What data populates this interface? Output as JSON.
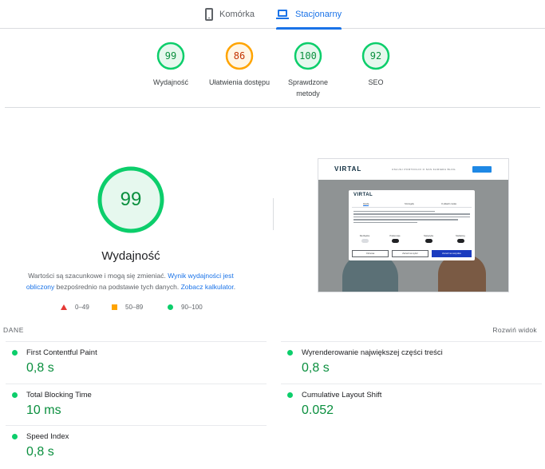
{
  "tabs": {
    "mobile_label": "Komórka",
    "desktop_label": "Stacjonarny",
    "mobile_icon": "smartphone-icon",
    "desktop_icon": "laptop-icon"
  },
  "summary": [
    {
      "score": "99",
      "label": "Wydajność",
      "status": "pass"
    },
    {
      "score": "86",
      "label": "Ułatwienia dostępu",
      "status": "average"
    },
    {
      "score": "100",
      "label": "Sprawdzone metody",
      "status": "pass"
    },
    {
      "score": "92",
      "label": "SEO",
      "status": "pass"
    }
  ],
  "colors": {
    "pass": "#0cce6b",
    "pass_text": "#0a8f3e",
    "average": "#ffa400",
    "average_text": "#c33300",
    "fail": "#e53935",
    "link": "#1a73e8"
  },
  "performance": {
    "score": "99",
    "title": "Wydajność",
    "note_prefix": "Wartości są szacunkowe i mogą się zmieniać.",
    "note_link1": "Wynik wydajności jest obliczony",
    "note_middle": "bezpośrednio na podstawie tych danych.",
    "note_link2": "Zobacz kalkulator",
    "note_suffix": "."
  },
  "legend": {
    "fail": "0–49",
    "average": "50–89",
    "pass": "90–100"
  },
  "screenshot": {
    "logo": "VIRTAL",
    "nav": "USŁUGI   PORTFOLIO   O NAS   KARIERA   BLOG",
    "modal_logo": "VIRTAL",
    "modal_tabs": [
      "Zgoda",
      "Szczegóły",
      "O plikach cookie"
    ],
    "modal_toggles": [
      "Niezbędne",
      "Preferencje",
      "Statystyka",
      "Marketing"
    ],
    "modal_buttons": [
      "Odmowa",
      "Zezwól na wybór",
      "Zezwól na wszystkie"
    ]
  },
  "metrics": {
    "header_left": "DANE",
    "header_right": "Rozwiń widok",
    "left": [
      {
        "name": "First Contentful Paint",
        "value": "0,8 s"
      },
      {
        "name": "Total Blocking Time",
        "value": "10 ms"
      },
      {
        "name": "Speed Index",
        "value": "0,8 s"
      }
    ],
    "right": [
      {
        "name": "Wyrenderowanie największej części treści",
        "value": "0,8 s"
      },
      {
        "name": "Cumulative Layout Shift",
        "value": "0.052"
      }
    ]
  }
}
